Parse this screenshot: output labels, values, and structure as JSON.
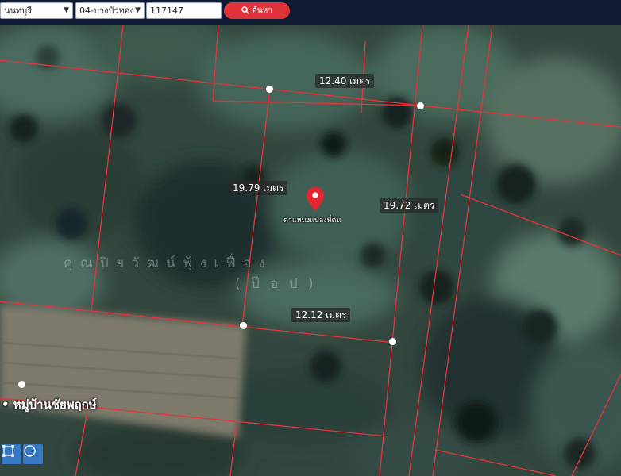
{
  "toolbar": {
    "province": "นนทบุรี",
    "district": "04-บางบัวทอง",
    "parcel_number": "117147",
    "search_label": "ค้นหา"
  },
  "map": {
    "measurements": {
      "top": "12.40 เมตร",
      "left": "19.79 เมตร",
      "right": "19.72 เมตร",
      "bottom": "12.12 เมตร"
    },
    "pin_label": "ตำแหน่งแปลงที่ดิน",
    "village_name_line1": "คุ ณ ปิ ย วั ฒ น์ ฟุ้ ง เ ฟื่ อ ง",
    "village_name_line2": "( ป๊ อ ป )",
    "road_label": "• หมู่บ้านชัยพฤกษ์"
  },
  "colors": {
    "boundary": "#e8333a",
    "search_button": "#e0343a",
    "topbar": "#0f1a33",
    "tool_button": "#3778c4"
  }
}
